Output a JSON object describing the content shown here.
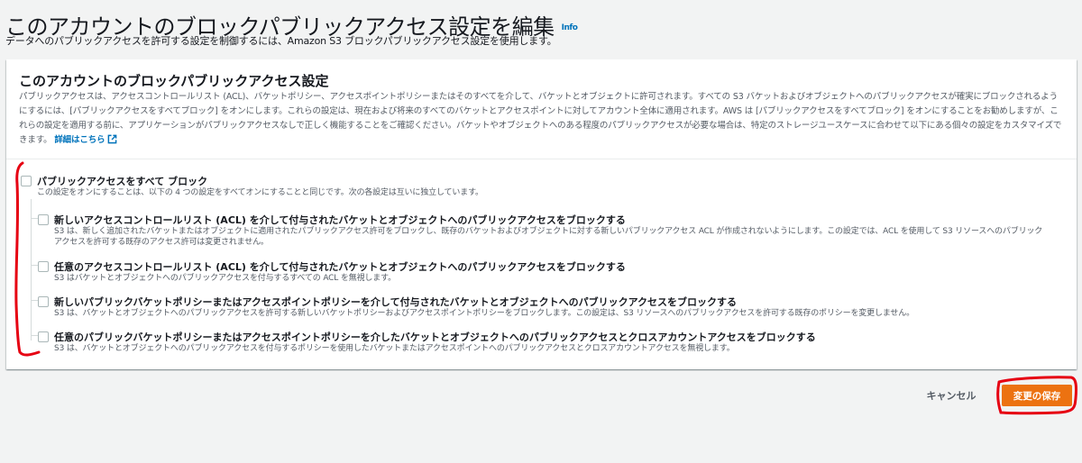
{
  "header": {
    "title": "このアカウントのブロックパブリックアクセス設定を編集",
    "info_label": "Info",
    "description": "データへのパブリックアクセスを許可する設定を制御するには、Amazon S3 ブロックパブリックアクセス設定を使用します。"
  },
  "panel": {
    "title": "このアカウントのブロックパブリックアクセス設定",
    "description": "パブリックアクセスは、アクセスコントロールリスト (ACL)、バケットポリシー、アクセスポイントポリシーまたはそのすべてを介して、バケットとオブジェクトに許可されます。すべての S3 バケットおよびオブジェクトへのパブリックアクセスが確実にブロックされるようにするには、[パブリックアクセスをすべてブロック] をオンにします。これらの設定は、現在および将来のすべてのバケットとアクセスポイントに対してアカウント全体に適用されます。AWS は [パブリックアクセスをすべてブロック] をオンにすることをお勧めしますが、これらの設定を適用する前に、アプリケーションがパブリックアクセスなしで正しく機能することをご確認ください。バケットやオブジェクトへのある程度のパブリックアクセスが必要な場合は、特定のストレージユースケースに合わせて以下にある個々の設定をカスタマイズできます。",
    "learn_more": "詳細はこちら",
    "block_all": {
      "label": "パブリックアクセスをすべて ブロック",
      "description": "この設定をオンにすることは、以下の 4 つの設定をすべてオンにすることと同じです。次の各設定は互いに独立しています。",
      "checked": false
    },
    "options": [
      {
        "label": "新しいアクセスコントロールリスト (ACL) を介して付与されたバケットとオブジェクトへのパブリックアクセスをブロックする",
        "description": "S3 は、新しく追加されたバケットまたはオブジェクトに適用されたパブリックアクセス許可をブロックし、既存のバケットおよびオブジェクトに対する新しいパブリックアクセス ACL が作成されないようにします。この設定では、ACL を使用して S3 リソースへのパブリックアクセスを許可する既存のアクセス許可は変更されません。",
        "checked": false
      },
      {
        "label": "任意のアクセスコントロールリスト (ACL) を介して付与されたバケットとオブジェクトへのパブリックアクセスをブロックする",
        "description": "S3 はバケットとオブジェクトへのパブリックアクセスを付与するすべての ACL を無視します。",
        "checked": false
      },
      {
        "label": "新しいパブリックバケットポリシーまたはアクセスポイントポリシーを介して付与されたバケットとオブジェクトへのパブリックアクセスをブロックする",
        "description": "S3 は、バケットとオブジェクトへのパブリックアクセスを許可する新しいバケットポリシーおよびアクセスポイントポリシーをブロックします。この設定は、S3 リソースへのパブリックアクセスを許可する既存のポリシーを変更しません。",
        "checked": false
      },
      {
        "label": "任意のパブリックバケットポリシーまたはアクセスポイントポリシーを介したバケットとオブジェクトへのパブリックアクセスとクロスアカウントアクセスをブロックする",
        "description": "S3 は、バケットとオブジェクトへのパブリックアクセスを付与するポリシーを使用したバケットまたはアクセスポイントへのパブリックアクセスとクロスアカウントアクセスを無視します。",
        "checked": false
      }
    ]
  },
  "actions": {
    "cancel_label": "キャンセル",
    "save_label": "変更の保存"
  },
  "colors": {
    "primary_button": "#ec7211",
    "link": "#0073bb",
    "annotation": "#e60012"
  },
  "icons": [
    "external-link-icon"
  ]
}
